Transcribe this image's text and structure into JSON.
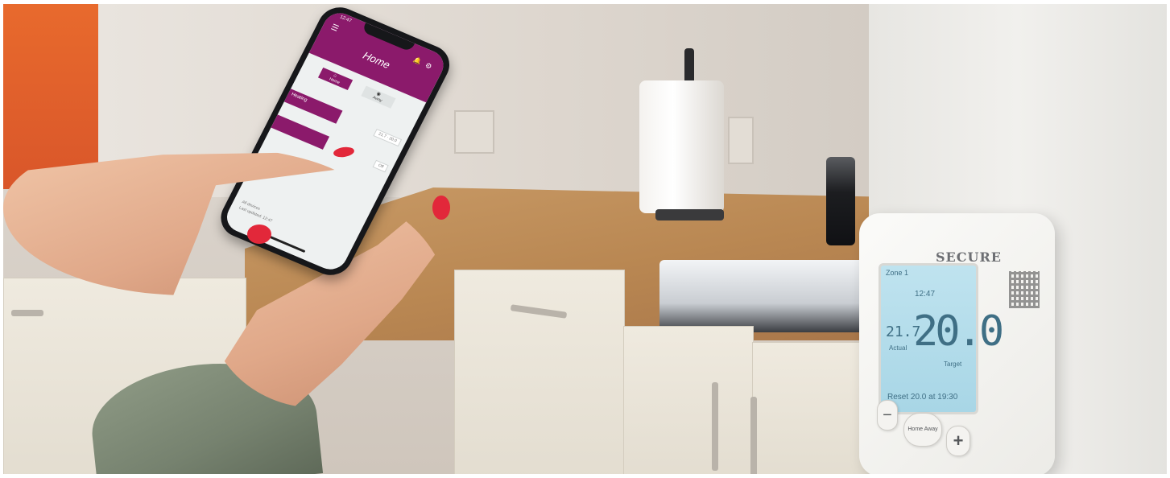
{
  "app": {
    "title": "Home",
    "status_time": "12:47",
    "icons": {
      "menu": "menu-icon",
      "bell": "bell-icon",
      "settings": "gear-icon"
    },
    "tabs": [
      {
        "label": "Home",
        "icon": "home-icon"
      },
      {
        "label": "Away",
        "icon": "away-icon"
      }
    ],
    "rows": [
      {
        "label": "Heating",
        "value": "21.7 · 20.0"
      },
      {
        "label": "",
        "value": "Off"
      }
    ],
    "footer": [
      "All devices",
      "Last updated: 12:47"
    ]
  },
  "thermostat": {
    "brand": "SECURE",
    "zone": "Zone 1",
    "time": "12:47",
    "target": "20.0",
    "target_label": "Target",
    "actual": "21.7",
    "actual_label": "Actual",
    "reset": "Reset 20.0 at 19:30",
    "buttons": {
      "minus": "−",
      "mode": "Home Away",
      "plus": "+"
    }
  },
  "colors": {
    "app_primary": "#8b1a6b",
    "thermostat_screen": "#bfe3ef",
    "nail_polish": "#e2283a"
  }
}
